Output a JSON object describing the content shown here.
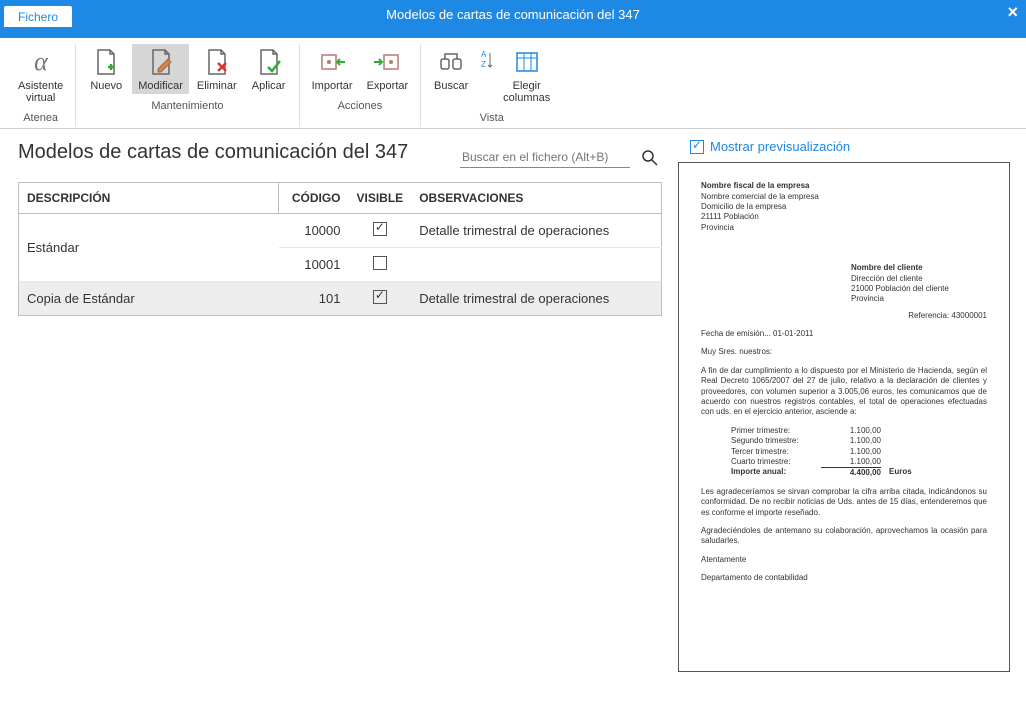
{
  "window": {
    "title": "Modelos de cartas de comunicación del 347"
  },
  "tabs": {
    "fichero": "Fichero"
  },
  "ribbon": {
    "atenea": {
      "group": "Atenea",
      "asistente": "Asistente\nvirtual"
    },
    "mantenimiento": {
      "group": "Mantenimiento",
      "nuevo": "Nuevo",
      "modificar": "Modificar",
      "eliminar": "Eliminar",
      "aplicar": "Aplicar"
    },
    "acciones": {
      "group": "Acciones",
      "importar": "Importar",
      "exportar": "Exportar"
    },
    "vista": {
      "group": "Vista",
      "buscar": "Buscar",
      "elegir_columnas": "Elegir\ncolumnas"
    }
  },
  "page": {
    "heading": "Modelos de cartas de comunicación del 347",
    "search_placeholder": "Buscar en el fichero (Alt+B)"
  },
  "grid": {
    "headers": {
      "descripcion": "DESCRIPCIÓN",
      "codigo": "CÓDIGO",
      "visible": "VISIBLE",
      "observaciones": "OBSERVACIONES"
    },
    "rows": [
      {
        "descripcion": "Estándar",
        "codigo": "10000",
        "visible": true,
        "observaciones": "Detalle trimestral de operaciones"
      },
      {
        "descripcion": "",
        "codigo": "10001",
        "visible": false,
        "observaciones": ""
      },
      {
        "descripcion": "Copia de Estándar",
        "codigo": "101",
        "visible": true,
        "observaciones": "Detalle trimestral de operaciones",
        "selected": true
      }
    ]
  },
  "preview": {
    "show_label": "Mostrar previsualización",
    "company": {
      "fiscal": "Nombre fiscal de la empresa",
      "comercial": "Nombre comercial de la empresa",
      "domicilio": "Domicilio de la empresa",
      "poblacion": "21111  Población",
      "provincia": "Provincia"
    },
    "client": {
      "name": "Nombre del cliente",
      "direccion": "Dirección del cliente",
      "poblacion": "21000  Población del cliente",
      "provincia": "Provincia"
    },
    "reference": "Referencia:  43000001",
    "fecha": "Fecha de emisión...   01-01-2011",
    "saludo": "Muy Sres. nuestros:",
    "body1": "A fin de dar cumplimiento a lo dispuesto por el Ministerio de Hacienda, según el Real Decreto 1065/2007 del 27 de julio, relativo a la declaración de clientes y proveedores, con volumen superior a 3.005,06 euros, les comunicamos que de acuerdo con nuestros registros contables, el total de operaciones efectuadas con uds. en el ejercicio anterior, asciende a:",
    "quarters": [
      {
        "label": "Primer trimestre:",
        "value": "1.100,00"
      },
      {
        "label": "Segundo trimestre:",
        "value": "1.100,00"
      },
      {
        "label": "Tercer trimestre:",
        "value": "1.100,00"
      },
      {
        "label": "Cuarto trimestre:",
        "value": "1.100,00"
      }
    ],
    "total": {
      "label": "Importe anual:",
      "value": "4.400,00",
      "currency": "Euros"
    },
    "body2": "Les agradeceríamos se sirvan comprobar la cifra arriba citada, indicándonos su conformidad. De no recibir noticias de Uds. antes de 15 días, entenderemos que es conforme el importe reseñado.",
    "body3": "Agradeciéndoles de antemano su colaboración, aprovechamos la ocasión para saludarles.",
    "despedida": "Atentamente",
    "dept": "Departamento de contabilidad"
  }
}
